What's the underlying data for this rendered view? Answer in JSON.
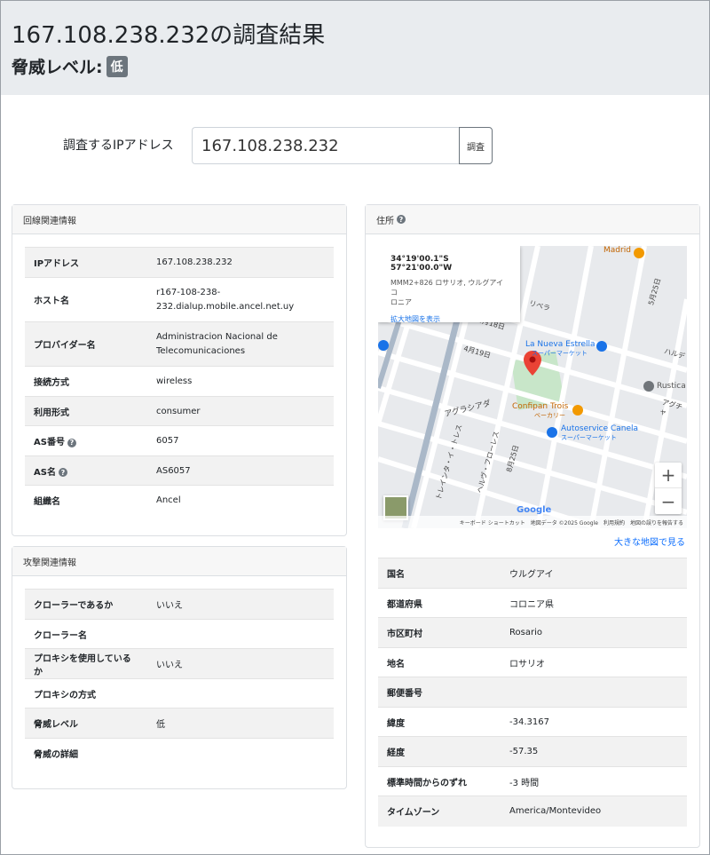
{
  "header": {
    "title": "167.108.238.232の調査結果",
    "threat_label": "脅威レベル:",
    "threat_badge": "低"
  },
  "search": {
    "label": "調査するIPアドレス",
    "value": "167.108.238.232",
    "button": "調査"
  },
  "line_info": {
    "title": "回線関連情報",
    "rows": [
      {
        "key": "IPアドレス",
        "value": "167.108.238.232"
      },
      {
        "key": "ホスト名",
        "value": "r167-108-238-",
        "value2": "232.dialup.mobile.ancel.net.uy"
      },
      {
        "key": "プロバイダー名",
        "value": "Administracion Nacional de",
        "value2": "Telecomunicaciones"
      },
      {
        "key": "接続方式",
        "value": "wireless"
      },
      {
        "key": "利用形式",
        "value": "consumer"
      },
      {
        "key": "AS番号",
        "value": "6057"
      },
      {
        "key": "AS名",
        "value": "AS6057"
      },
      {
        "key": "組織名",
        "value": "Ancel"
      }
    ]
  },
  "attack_info": {
    "title": "攻撃関連情報",
    "rows": [
      {
        "key": "クローラーであるか",
        "value": "いいえ"
      },
      {
        "key": "クローラー名",
        "value": ""
      },
      {
        "key": "プロキシを使用しているか",
        "value": "いいえ"
      },
      {
        "key": "プロキシの方式",
        "value": ""
      },
      {
        "key": "脅威レベル",
        "value": "低"
      },
      {
        "key": "脅威の詳細",
        "value": ""
      }
    ]
  },
  "address": {
    "title": "住所",
    "map": {
      "popup_coord": "34°19'00.1\"S 57°21'00.0\"W",
      "popup_addr1": "MMM2+826 ロサリオ, ウルグアイ コ",
      "popup_addr2": "ロニア",
      "popup_link": "拡大地図を表示",
      "zoom_in": "+",
      "zoom_out": "−",
      "labels": {
        "madrid": "Madrid",
        "la_nueva": "La Nueva Estrella",
        "super1": "スーパーマーケット",
        "rustica": "Rustica",
        "confipan": "Confipan Trois",
        "bakery": "ベーカリー",
        "autoservice": "Autoservice Canela",
        "super2": "スーパーマーケット",
        "agraciada": "アグラシアダ",
        "april19": "4月19日",
        "april18": "4月18日",
        "may25a": "5月25日",
        "may25b": "8月25日",
        "treinta": "トレインタ・イ・トレス",
        "herrera": "ヘルヴ・フローレス",
        "hale": "ハルデ",
        "abecho": "アグチャ",
        "rivera": "リベラ",
        "google": "Google"
      },
      "footer": {
        "keyboard": "キーボード ショートカット",
        "mapdata": "地図データ ©2025 Google",
        "terms": "利用規約",
        "report": "地図の誤りを報告する"
      }
    },
    "big_map_link": "大きな地図で見る",
    "rows": [
      {
        "key": "国名",
        "value": "ウルグアイ"
      },
      {
        "key": "都道府県",
        "value": "コロニア県"
      },
      {
        "key": "市区町村",
        "value": "Rosario"
      },
      {
        "key": "地名",
        "value": "ロサリオ"
      },
      {
        "key": "郵便番号",
        "value": ""
      },
      {
        "key": "緯度",
        "value": "-34.3167"
      },
      {
        "key": "経度",
        "value": "-57.35"
      },
      {
        "key": "標準時間からのずれ",
        "value": "-3 時間"
      },
      {
        "key": "タイムゾーン",
        "value": "America/Montevideo"
      }
    ]
  },
  "colors": {
    "header_bg": "#e9ecef",
    "badge": "#6c757d",
    "link": "#0d6efd",
    "marker": "#ea4335"
  }
}
